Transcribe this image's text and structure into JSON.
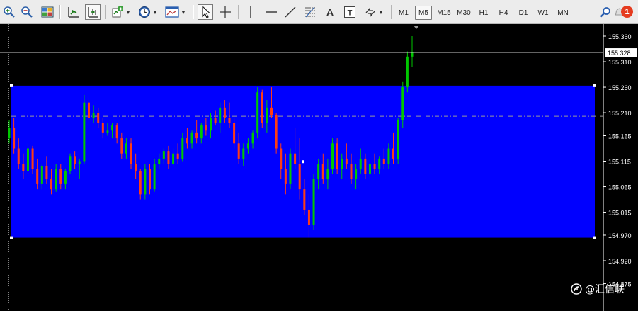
{
  "toolbar": {
    "timeframes": [
      "M1",
      "M5",
      "M15",
      "M30",
      "H1",
      "H4",
      "D1",
      "W1",
      "MN"
    ],
    "active_timeframe": "M5",
    "text_tool_label": "A",
    "notification_count": "1",
    "icons": [
      "zoom-in-icon",
      "zoom-out-icon",
      "tile-windows-icon",
      "chart-shift-icon",
      "autoscroll-icon",
      "add-indicator-icon",
      "period-clock-icon",
      "templates-icon",
      "cursor-icon",
      "crosshair-icon",
      "vertical-line-icon",
      "horizontal-line-icon",
      "trendline-icon",
      "fibonacci-icon",
      "text-icon",
      "text-label-icon",
      "arrows-icon",
      "search-icon",
      "notification-icon"
    ]
  },
  "colors": {
    "background": "#000000",
    "rectangle": "#0000ff",
    "bull": "#00c800",
    "bear": "#ff3c14",
    "axis_text": "#ffffff",
    "grid_text": "#cfcfcf"
  },
  "chart_data": {
    "type": "candlestick",
    "symbol_price_current": 155.328,
    "y_ticks": [
      "155.360",
      "155.310",
      "155.260",
      "155.210",
      "155.165",
      "155.115",
      "155.065",
      "155.015",
      "154.970",
      "154.920",
      "154.875"
    ],
    "ylim": [
      154.87,
      155.4
    ],
    "rectangle": {
      "price_top": 155.263,
      "price_bottom": 154.965
    },
    "horizontal_dashed_level": 155.203,
    "current_price_label": "155.328",
    "bars": [
      [
        155.16,
        155.195,
        155.15,
        155.18
      ],
      [
        155.18,
        155.2,
        155.13,
        155.14
      ],
      [
        155.14,
        155.16,
        155.1,
        155.11
      ],
      [
        155.11,
        155.13,
        155.08,
        155.095
      ],
      [
        155.095,
        155.15,
        155.09,
        155.14
      ],
      [
        155.14,
        155.145,
        155.09,
        155.1
      ],
      [
        155.1,
        155.12,
        155.06,
        155.07
      ],
      [
        155.07,
        155.11,
        155.06,
        155.105
      ],
      [
        155.105,
        155.125,
        155.07,
        155.08
      ],
      [
        155.08,
        155.1,
        155.05,
        155.06
      ],
      [
        155.06,
        155.11,
        155.055,
        155.1
      ],
      [
        155.1,
        155.11,
        155.06,
        155.07
      ],
      [
        155.07,
        155.1,
        155.06,
        155.095
      ],
      [
        155.095,
        155.13,
        155.09,
        155.125
      ],
      [
        155.125,
        155.135,
        155.1,
        155.11
      ],
      [
        155.11,
        155.12,
        155.08,
        155.115
      ],
      [
        155.115,
        155.245,
        155.11,
        155.23
      ],
      [
        155.23,
        155.24,
        155.19,
        155.2
      ],
      [
        155.2,
        155.225,
        155.19,
        155.21
      ],
      [
        155.21,
        155.22,
        155.18,
        155.19
      ],
      [
        155.19,
        155.2,
        155.16,
        155.17
      ],
      [
        155.17,
        155.19,
        155.165,
        155.175
      ],
      [
        155.175,
        155.19,
        155.16,
        155.185
      ],
      [
        155.185,
        155.19,
        155.15,
        155.16
      ],
      [
        155.16,
        155.17,
        155.12,
        155.13
      ],
      [
        155.13,
        155.16,
        155.12,
        155.15
      ],
      [
        155.15,
        155.16,
        155.1,
        155.11
      ],
      [
        155.11,
        155.13,
        155.08,
        155.095
      ],
      [
        155.095,
        155.1,
        155.04,
        155.05
      ],
      [
        155.05,
        155.11,
        155.04,
        155.1
      ],
      [
        155.1,
        155.11,
        155.05,
        155.06
      ],
      [
        155.06,
        155.12,
        155.055,
        155.11
      ],
      [
        155.11,
        155.13,
        155.1,
        155.12
      ],
      [
        155.12,
        155.14,
        155.11,
        155.135
      ],
      [
        155.135,
        155.145,
        155.1,
        155.11
      ],
      [
        155.11,
        155.14,
        155.105,
        155.13
      ],
      [
        155.13,
        155.15,
        155.11,
        155.12
      ],
      [
        155.12,
        155.17,
        155.115,
        155.16
      ],
      [
        155.16,
        155.18,
        155.14,
        155.15
      ],
      [
        155.15,
        155.175,
        155.14,
        155.17
      ],
      [
        155.17,
        155.195,
        155.15,
        155.16
      ],
      [
        155.16,
        155.19,
        155.15,
        155.185
      ],
      [
        155.185,
        155.2,
        155.165,
        155.175
      ],
      [
        155.175,
        155.21,
        155.16,
        155.2
      ],
      [
        155.2,
        155.215,
        155.185,
        155.19
      ],
      [
        155.19,
        155.23,
        155.17,
        155.22
      ],
      [
        155.22,
        155.235,
        155.19,
        155.2
      ],
      [
        155.2,
        155.23,
        155.18,
        155.19
      ],
      [
        155.19,
        155.2,
        155.14,
        155.15
      ],
      [
        155.15,
        155.17,
        155.11,
        155.12
      ],
      [
        155.12,
        155.15,
        155.105,
        155.14
      ],
      [
        155.14,
        155.16,
        155.13,
        155.15
      ],
      [
        155.15,
        155.175,
        155.14,
        155.17
      ],
      [
        155.17,
        155.26,
        155.16,
        155.25
      ],
      [
        155.25,
        155.255,
        155.18,
        155.19
      ],
      [
        155.19,
        155.235,
        155.17,
        155.22
      ],
      [
        155.22,
        155.26,
        155.2,
        155.205
      ],
      [
        155.205,
        155.21,
        155.13,
        155.14
      ],
      [
        155.14,
        155.15,
        155.08,
        155.1
      ],
      [
        155.1,
        155.13,
        155.05,
        155.07
      ],
      [
        155.07,
        155.14,
        155.06,
        155.13
      ],
      [
        155.13,
        155.18,
        155.1,
        155.11
      ],
      [
        155.11,
        155.16,
        155.04,
        155.06
      ],
      [
        155.06,
        155.08,
        155.01,
        155.02
      ],
      [
        155.02,
        155.05,
        154.965,
        154.99
      ],
      [
        154.99,
        155.09,
        154.98,
        155.08
      ],
      [
        155.08,
        155.12,
        155.06,
        155.11
      ],
      [
        155.11,
        155.13,
        155.07,
        155.08
      ],
      [
        155.08,
        155.12,
        155.06,
        155.1
      ],
      [
        155.1,
        155.16,
        155.09,
        155.15
      ],
      [
        155.15,
        155.16,
        155.09,
        155.1
      ],
      [
        155.1,
        155.13,
        155.08,
        155.12
      ],
      [
        155.12,
        155.15,
        155.1,
        155.11
      ],
      [
        155.11,
        155.13,
        155.07,
        155.08
      ],
      [
        155.08,
        155.11,
        155.06,
        155.1
      ],
      [
        155.1,
        155.14,
        155.09,
        155.12
      ],
      [
        155.12,
        155.13,
        155.08,
        155.09
      ],
      [
        155.09,
        155.12,
        155.08,
        155.11
      ],
      [
        155.11,
        155.13,
        155.09,
        155.1
      ],
      [
        155.1,
        155.125,
        155.09,
        155.12
      ],
      [
        155.12,
        155.14,
        155.1,
        155.11
      ],
      [
        155.11,
        155.15,
        155.1,
        155.14
      ],
      [
        155.14,
        155.17,
        155.11,
        155.12
      ],
      [
        155.12,
        155.2,
        155.11,
        155.195
      ],
      [
        155.195,
        155.27,
        155.18,
        155.26
      ],
      [
        155.26,
        155.33,
        155.25,
        155.32
      ],
      [
        155.32,
        155.36,
        155.3,
        155.328
      ]
    ]
  },
  "watermark": {
    "text": "@汇信联"
  }
}
